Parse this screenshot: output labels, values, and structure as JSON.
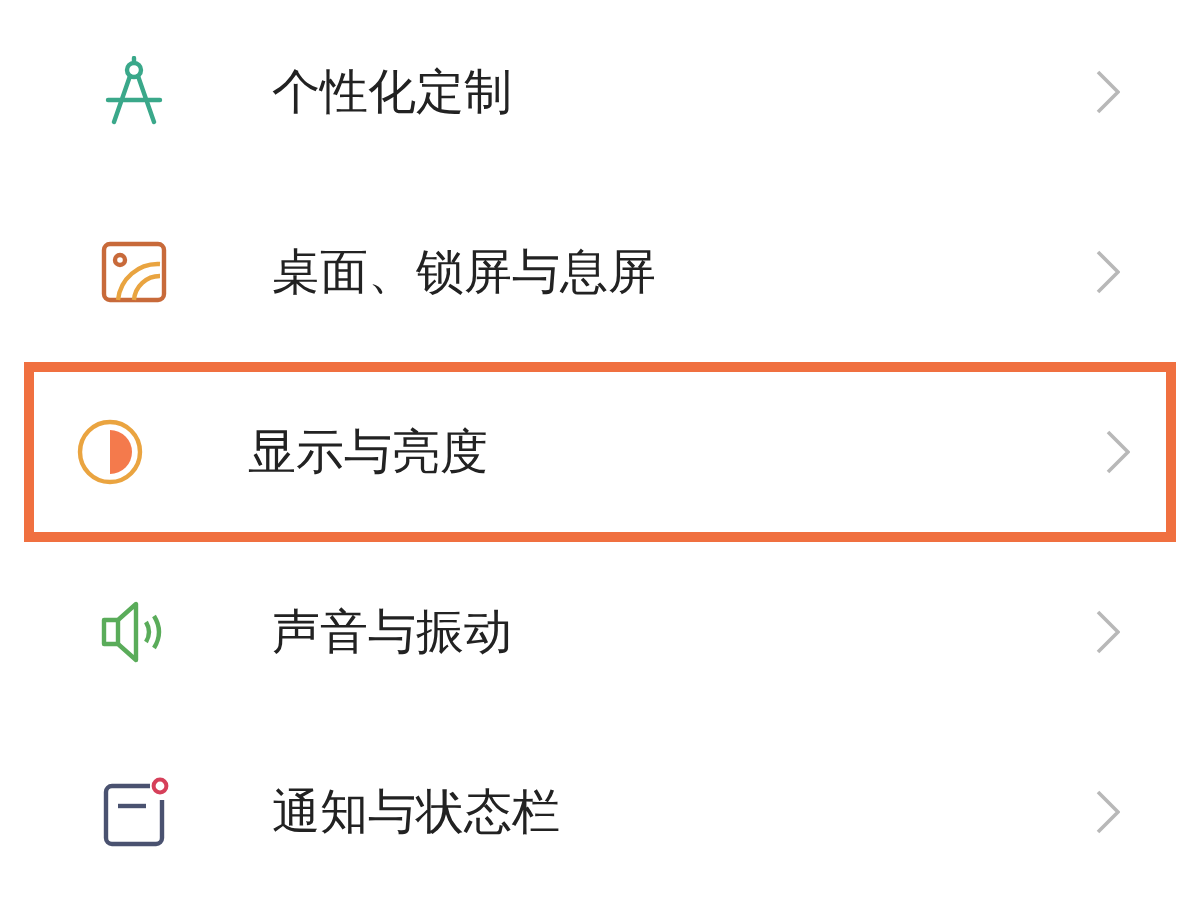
{
  "settings": [
    {
      "kind": "compass",
      "label": "个性化定制",
      "highlighted": false
    },
    {
      "kind": "wallpaper",
      "label": "桌面、锁屏与息屏",
      "highlighted": false
    },
    {
      "kind": "display",
      "label": "显示与亮度",
      "highlighted": true
    },
    {
      "kind": "sound",
      "label": "声音与振动",
      "highlighted": false
    },
    {
      "kind": "notification",
      "label": "通知与状态栏",
      "highlighted": false
    }
  ]
}
